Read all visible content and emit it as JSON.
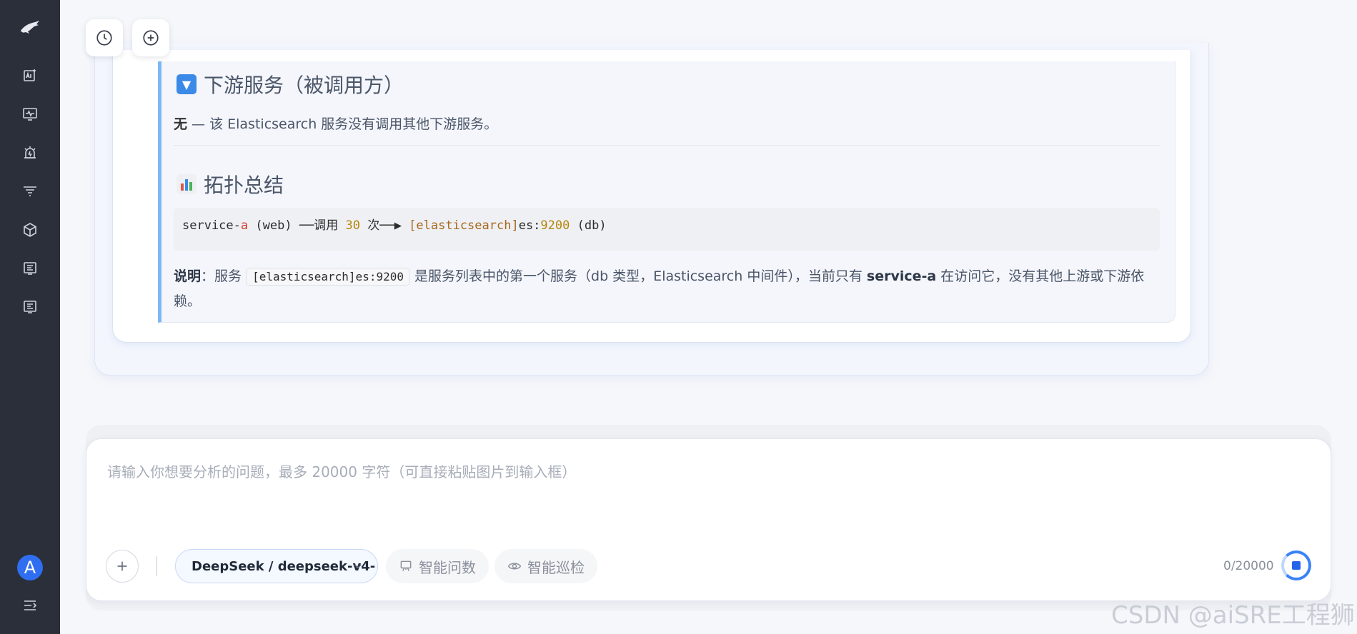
{
  "top_buttons": {
    "history_icon": "clock-icon",
    "new_icon": "plus-circle-icon"
  },
  "sidebar": {
    "icons": [
      "logo-icon",
      "ai-chart-icon",
      "monitor-icon",
      "alarm-icon",
      "filter-icon",
      "cube-icon",
      "list-icon",
      "list-alt-icon"
    ],
    "avatar_letter": "A",
    "collapse_icon": "collapse-menu-icon"
  },
  "message": {
    "downstream_heading": "下游服务（被调用方）",
    "downstream_text_bold": "无",
    "downstream_text": " — 该 Elasticsearch 服务没有调用其他下游服务。",
    "topology_heading": "拓扑总结",
    "code": {
      "p1": "service-",
      "p2": "a",
      "p3": " (web) ──调用 ",
      "p4": "30",
      "p5": " 次──▶ ",
      "p6": "[elasticsearch]",
      "p7": "es:",
      "p8": "9200",
      "p9": " (db)"
    },
    "note_label": "说明",
    "note_colon": "：服务 ",
    "note_code": "[elasticsearch]es:9200",
    "note_mid": " 是服务列表中的第一个服务（db 类型，Elasticsearch 中间件），当前只有 ",
    "note_bold": "service-a",
    "note_end": " 在访问它，没有其他上游或下游依赖。"
  },
  "input": {
    "placeholder": "请输入你想要分析的问题，最多 20000 字符（可直接粘贴图片到输入框）",
    "model": "DeepSeek / deepseek-v4-",
    "mode1": "智能问数",
    "mode2": "智能巡检",
    "counter": "0/20000"
  },
  "watermark": "CSDN @aiSRE工程狮",
  "colors": {
    "sidebar_bg": "#2b2f3a",
    "accent": "#3b82f6",
    "quote_border": "#7eb6f6"
  }
}
